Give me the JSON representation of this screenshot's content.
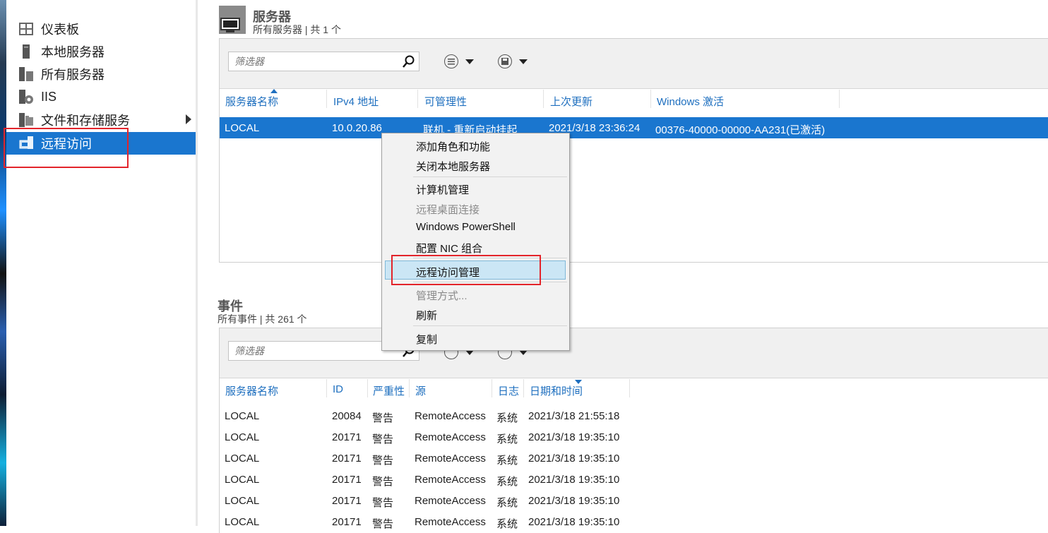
{
  "sidebar": {
    "items": [
      {
        "label": "仪表板",
        "icon": "dashboard-icon"
      },
      {
        "label": "本地服务器",
        "icon": "server-icon"
      },
      {
        "label": "所有服务器",
        "icon": "servers-icon"
      },
      {
        "label": "IIS",
        "icon": "iis-icon"
      },
      {
        "label": "文件和存储服务",
        "icon": "file-storage-icon"
      },
      {
        "label": "远程访问",
        "icon": "remote-access-icon"
      }
    ]
  },
  "servers": {
    "title": "服务器",
    "subtitle": "所有服务器 | 共 1 个",
    "filter_placeholder": "筛选器",
    "columns": [
      "服务器名称",
      "IPv4 地址",
      "可管理性",
      "上次更新",
      "Windows 激活"
    ],
    "rows": [
      [
        "LOCAL",
        "10.0.20.86",
        "联机 - 重新启动挂起",
        "2021/3/18 23:36:24",
        "00376-40000-00000-AA231(已激活)"
      ]
    ]
  },
  "context_menu": {
    "items": [
      {
        "label": "添加角色和功能",
        "enabled": true
      },
      {
        "label": "关闭本地服务器",
        "enabled": true
      },
      {
        "label": "计算机管理",
        "enabled": true
      },
      {
        "label": "远程桌面连接",
        "enabled": false
      },
      {
        "label": "Windows PowerShell",
        "enabled": true
      },
      {
        "label": "配置 NIC 组合",
        "enabled": true
      },
      {
        "label": "远程访问管理",
        "enabled": true
      },
      {
        "label": "管理方式...",
        "enabled": false
      },
      {
        "label": "刷新",
        "enabled": true
      },
      {
        "label": "复制",
        "enabled": true
      }
    ]
  },
  "events": {
    "title": "事件",
    "subtitle": "所有事件 | 共 261 个",
    "filter_placeholder": "筛选器",
    "columns": [
      "服务器名称",
      "ID",
      "严重性",
      "源",
      "日志",
      "日期和时间"
    ],
    "rows": [
      [
        "LOCAL",
        "20084",
        "警告",
        "RemoteAccess",
        "系统",
        "2021/3/18 21:55:18"
      ],
      [
        "LOCAL",
        "20171",
        "警告",
        "RemoteAccess",
        "系统",
        "2021/3/18 19:35:10"
      ],
      [
        "LOCAL",
        "20171",
        "警告",
        "RemoteAccess",
        "系统",
        "2021/3/18 19:35:10"
      ],
      [
        "LOCAL",
        "20171",
        "警告",
        "RemoteAccess",
        "系统",
        "2021/3/18 19:35:10"
      ],
      [
        "LOCAL",
        "20171",
        "警告",
        "RemoteAccess",
        "系统",
        "2021/3/18 19:35:10"
      ],
      [
        "LOCAL",
        "20171",
        "警告",
        "RemoteAccess",
        "系统",
        "2021/3/18 19:35:10"
      ]
    ]
  },
  "colors": {
    "accent": "#1a76cf",
    "highlight_annotation": "#e3242b",
    "menu_hover": "#cbe6f5"
  }
}
